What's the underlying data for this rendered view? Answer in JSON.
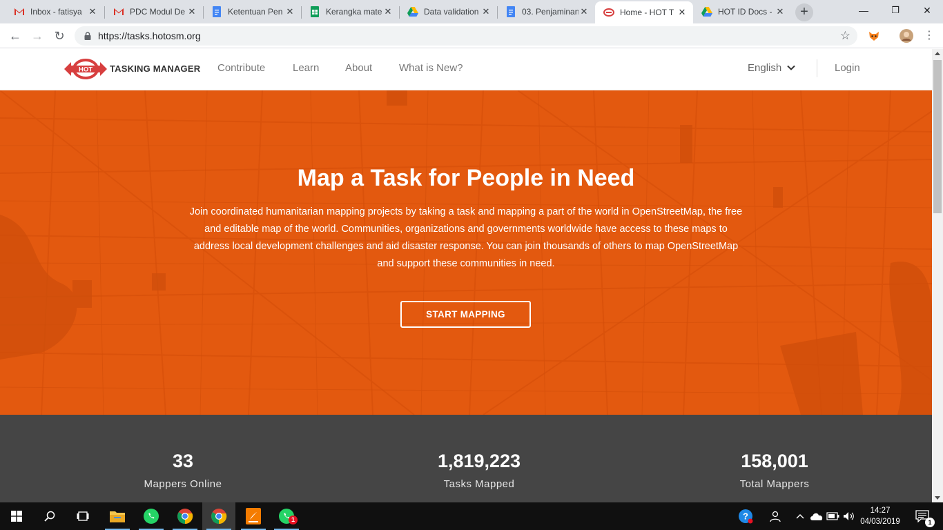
{
  "browser": {
    "tabs": [
      {
        "title": "Inbox - fatisya",
        "icon": "gmail-icon"
      },
      {
        "title": "PDC Modul De",
        "icon": "gmail-icon"
      },
      {
        "title": "Ketentuan Pen",
        "icon": "docs-icon"
      },
      {
        "title": "Kerangka mate",
        "icon": "sheets-icon"
      },
      {
        "title": "Data validation",
        "icon": "drive-icon"
      },
      {
        "title": "03. Penjaminan",
        "icon": "docs-icon"
      },
      {
        "title": "Home - HOT T",
        "icon": "hot-icon",
        "active": true
      },
      {
        "title": "HOT ID Docs -",
        "icon": "drive-icon"
      }
    ],
    "new_tab": "+",
    "url": "https://tasks.hotosm.org",
    "minimize": "—",
    "maximize": "❐",
    "close": "✕"
  },
  "site": {
    "logo_text": "HOT",
    "brand": "TASKING MANAGER",
    "nav": [
      "Contribute",
      "Learn",
      "About",
      "What is New?"
    ],
    "language": "English",
    "login": "Login"
  },
  "hero": {
    "title": "Map a Task for People in Need",
    "text": "Join coordinated humanitarian mapping projects by taking a task and mapping a part of the world in OpenStreetMap, the free and editable map of the world. Communities, organizations and governments worldwide have access to these maps to address local development challenges and aid disaster response. You can join thousands of others to map OpenStreetMap and support these communities in need.",
    "button": "START MAPPING"
  },
  "stats": [
    {
      "value": "33",
      "label": "Mappers Online"
    },
    {
      "value": "1,819,223",
      "label": "Tasks Mapped"
    },
    {
      "value": "158,001",
      "label": "Total Mappers"
    }
  ],
  "taskbar": {
    "time": "14:27",
    "date": "04/03/2019",
    "notification_count": "1",
    "whatsapp_badge": "1"
  },
  "colors": {
    "hero": "#e3590f",
    "stats": "#454545",
    "hot_red": "#d73f3f"
  }
}
